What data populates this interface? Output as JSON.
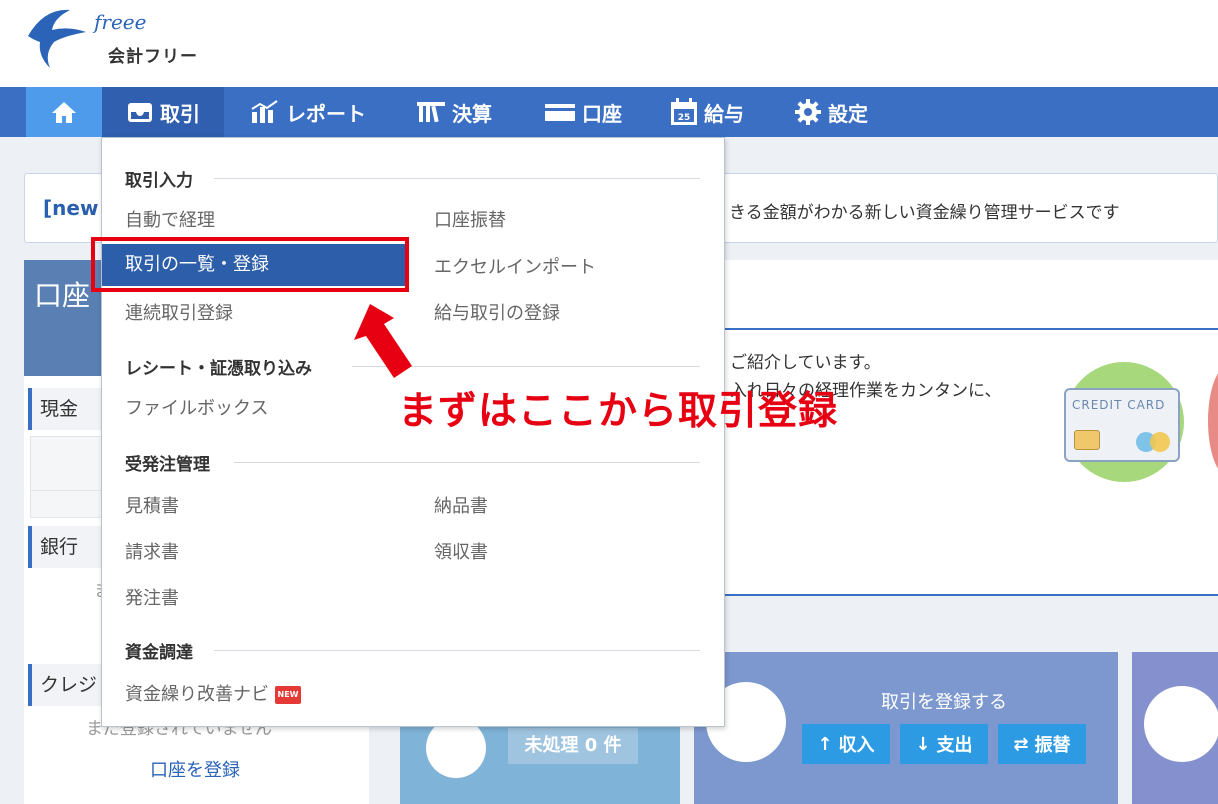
{
  "logo": {
    "script_text": "freee",
    "product_name": "会計フリー"
  },
  "nav": {
    "items": [
      {
        "label": "",
        "icon": "home-icon"
      },
      {
        "label": "取引",
        "icon": "inbox-icon"
      },
      {
        "label": "レポート",
        "icon": "chart-icon"
      },
      {
        "label": "決算",
        "icon": "books-icon"
      },
      {
        "label": "口座",
        "icon": "card-icon"
      },
      {
        "label": "給与",
        "icon": "calendar-icon"
      },
      {
        "label": "設定",
        "icon": "gear-icon"
      }
    ]
  },
  "background": {
    "banner_new": "[new!",
    "banner_text": "きる金額がわかる新しい資金繰り管理サービスです",
    "accounts_title": "口座",
    "cash_label": "現金",
    "bank_label": "銀行",
    "credit_label": "クレジ",
    "bank_faint": "ま",
    "credit_faint": "まだ登録されていません",
    "register_account_link": "口座を登録",
    "main_text_1": "ご紹介しています。",
    "main_text_2": "入れ日々の経理作業をカンタンに、",
    "credit_card_label": "CREDIT CARD",
    "unprocessed_badge": "未処理 0 件",
    "register_deal_title": "取引を登録する",
    "btn_income": "収入",
    "btn_expense": "支出",
    "btn_transfer": "振替"
  },
  "dropdown": {
    "sections": [
      {
        "title": "取引入力"
      },
      {
        "title": "レシート・証憑取り込み"
      },
      {
        "title": "受発注管理"
      },
      {
        "title": "資金調達"
      }
    ],
    "items": {
      "auto_accounting": "自動で経理",
      "account_transfer": "口座振替",
      "deal_list_register": "取引の一覧・登録",
      "excel_import": "エクセルインポート",
      "continuous_register": "連続取引登録",
      "payroll_register": "給与取引の登録",
      "file_box": "ファイルボックス",
      "estimate": "見積書",
      "delivery_note": "納品書",
      "invoice": "請求書",
      "receipt": "領収書",
      "purchase_order": "発注書",
      "cashflow_navi": "資金繰り改善ナビ",
      "new_badge": "NEW"
    }
  },
  "annotation": {
    "callout": "まずはここから取引登録"
  },
  "colors": {
    "nav_blue": "#3a6fc4",
    "active_blue": "#2c5ea9",
    "annotation_red": "#e60012"
  }
}
